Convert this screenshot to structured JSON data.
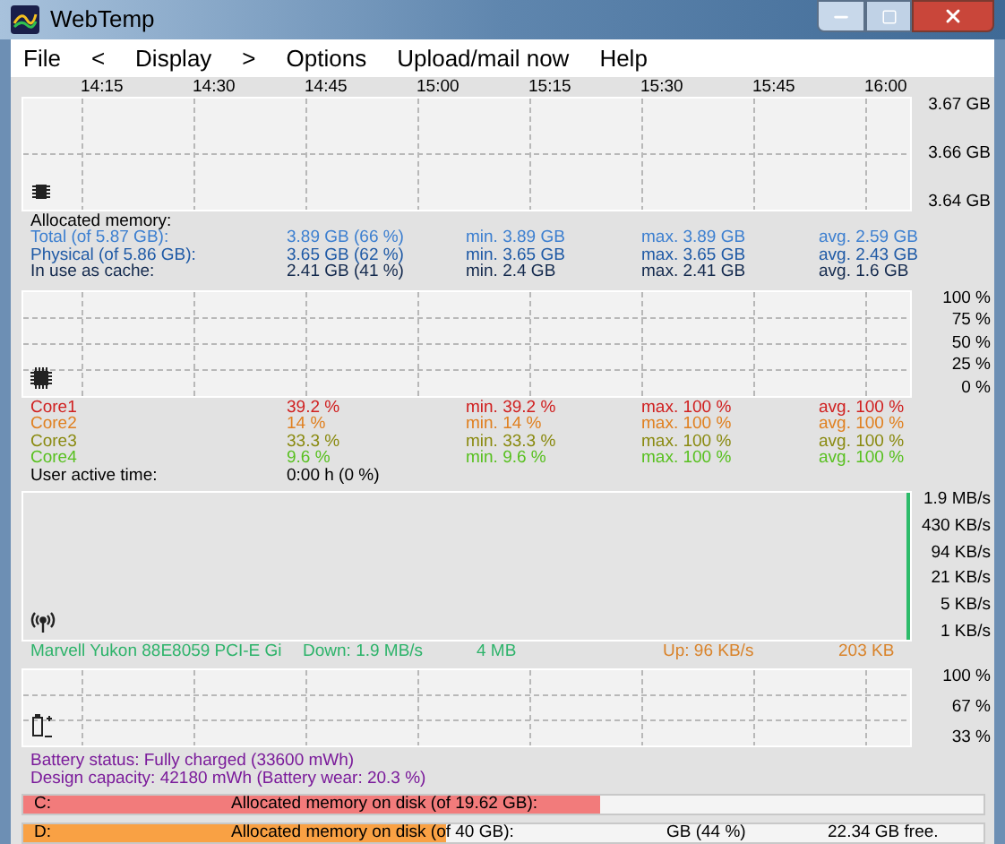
{
  "window": {
    "title": "WebTemp"
  },
  "menu": [
    "File",
    "<",
    "Display",
    ">",
    "Options",
    "Upload/mail now",
    "Help"
  ],
  "time_ticks": [
    "14:15",
    "14:30",
    "14:45",
    "15:00",
    "15:15",
    "15:30",
    "15:45",
    "16:00"
  ],
  "memory": {
    "y_labels": [
      "3.67 GB",
      "3.66 GB",
      "3.64 GB"
    ],
    "heading": "Allocated memory:",
    "rows": [
      {
        "label": "Total (of 5.87 GB):",
        "value": "3.89 GB (66 %)",
        "min": "min. 3.89 GB",
        "max": "max. 3.89 GB",
        "avg": "avg. 2.59 GB",
        "color": "#3c7fd0"
      },
      {
        "label": "Physical (of 5.86 GB):",
        "value": "3.65 GB (62 %)",
        "min": "min. 3.65 GB",
        "max": "max. 3.65 GB",
        "avg": "avg. 2.43 GB",
        "color": "#1f5aa6"
      },
      {
        "label": "In use as cache:",
        "value": "2.41 GB (41 %)",
        "min": "min. 2.4 GB",
        "max": "max. 2.41 GB",
        "avg": "avg. 1.6 GB",
        "color": "#13294d"
      }
    ]
  },
  "cpu": {
    "y_labels": [
      "100 %",
      "75 %",
      "50 %",
      "25 %",
      "0 %"
    ],
    "rows": [
      {
        "label": "Core1",
        "value": "39.2 %",
        "min": "min. 39.2 %",
        "max": "max. 100 %",
        "avg": "avg. 100 %",
        "color": "#d02020"
      },
      {
        "label": "Core2",
        "value": "14 %",
        "min": "min. 14 %",
        "max": "max. 100 %",
        "avg": "avg. 100 %",
        "color": "#e08020"
      },
      {
        "label": "Core3",
        "value": "33.3 %",
        "min": "min. 33.3 %",
        "max": "max. 100 %",
        "avg": "avg. 100 %",
        "color": "#8a8a10"
      },
      {
        "label": "Core4",
        "value": "9.6 %",
        "min": "min. 9.6 %",
        "max": "max. 100 %",
        "avg": "avg. 100 %",
        "color": "#58c020"
      }
    ],
    "active": {
      "label": "User active time:",
      "value": "0:00 h (0 %)"
    }
  },
  "network": {
    "y_labels": [
      "1.9 MB/s",
      "430 KB/s",
      "94 KB/s",
      "21 KB/s",
      "5 KB/s",
      "1 KB/s"
    ],
    "adapter": "Marvell Yukon 88E8059 PCI-E Gi",
    "down": "Down: 1.9 MB/s",
    "down_total": "4 MB",
    "up": "Up: 96 KB/s",
    "up_total": "203 KB"
  },
  "battery": {
    "y_labels": [
      "100 %",
      "67 %",
      "33 %"
    ],
    "lines": [
      "Battery status: Fully charged (33600 mWh)",
      "Design capacity: 42180 mWh (Battery wear: 20.3 %)"
    ]
  },
  "disks": [
    {
      "letter": "C:",
      "label": "Allocated memory on disk (of 19.62 GB):",
      "level": 0.6,
      "color": "#f27b7b"
    },
    {
      "letter": "D:",
      "label": "Allocated memory on disk (of 40 GB):",
      "used": "GB (44 %)",
      "free": "22.34 GB free.",
      "level": 0.44,
      "color": "#f9a144"
    }
  ]
}
